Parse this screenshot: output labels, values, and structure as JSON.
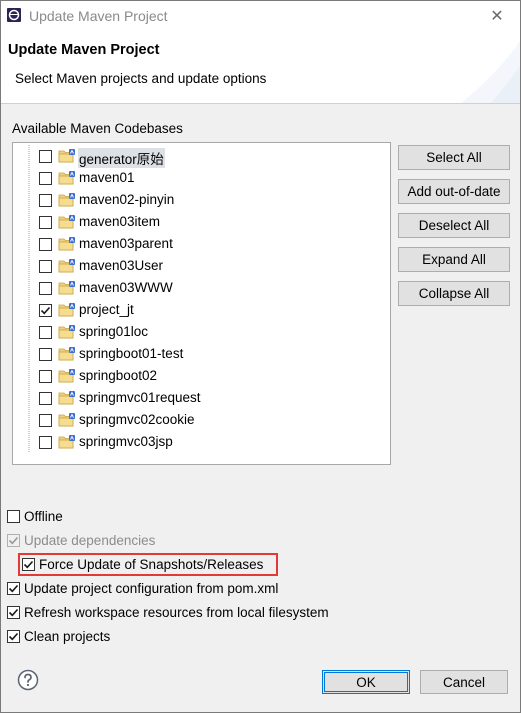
{
  "window": {
    "title": "Update Maven Project",
    "close_glyph": "✕"
  },
  "header": {
    "title": "Update Maven Project",
    "description": "Select Maven projects and update options"
  },
  "codebases": {
    "label": "Available Maven Codebases",
    "items": [
      {
        "label": "generator原始",
        "checked": false,
        "selected": true
      },
      {
        "label": "maven01",
        "checked": false
      },
      {
        "label": "maven02-pinyin",
        "checked": false
      },
      {
        "label": "maven03item",
        "checked": false
      },
      {
        "label": "maven03parent",
        "checked": false
      },
      {
        "label": "maven03User",
        "checked": false
      },
      {
        "label": "maven03WWW",
        "checked": false
      },
      {
        "label": "project_jt",
        "checked": true
      },
      {
        "label": "spring01loc",
        "checked": false
      },
      {
        "label": "springboot01-test",
        "checked": false
      },
      {
        "label": "springboot02",
        "checked": false
      },
      {
        "label": "springmvc01request",
        "checked": false
      },
      {
        "label": "springmvc02cookie",
        "checked": false
      },
      {
        "label": "springmvc03jsp",
        "checked": false
      }
    ]
  },
  "side_buttons": {
    "select_all": "Select All",
    "add_out_of_date": "Add out-of-date",
    "deselect_all": "Deselect All",
    "expand_all": "Expand All",
    "collapse_all": "Collapse All"
  },
  "options": {
    "offline": {
      "label": "Offline",
      "checked": false
    },
    "update_dependencies": {
      "label": "Update dependencies",
      "checked": true,
      "disabled": true
    },
    "force_update": {
      "label": "Force Update of Snapshots/Releases",
      "checked": true
    },
    "update_config": {
      "label": "Update project configuration from pom.xml",
      "checked": true
    },
    "refresh_workspace": {
      "label": "Refresh workspace resources from local filesystem",
      "checked": true
    },
    "clean_projects": {
      "label": "Clean projects",
      "checked": true
    }
  },
  "footer": {
    "ok": "OK",
    "cancel": "Cancel",
    "help_icon": "help-icon"
  },
  "colors": {
    "highlight": "#e53935",
    "folder": "#e8c46b",
    "accent": "#0078d7"
  }
}
